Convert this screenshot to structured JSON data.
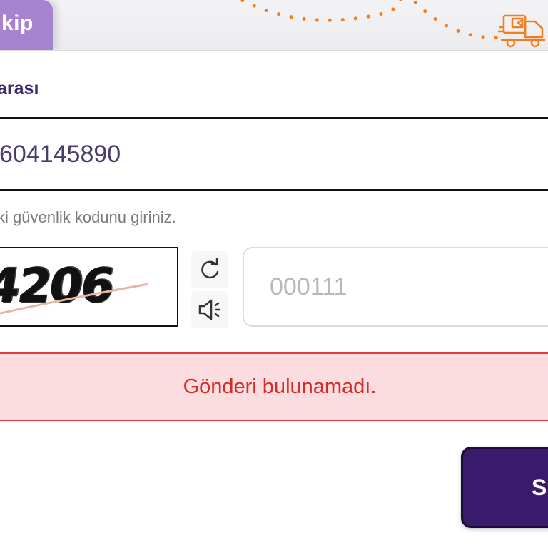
{
  "header": {
    "track_tab_label": "kip"
  },
  "tracking": {
    "label": "arası",
    "value": "604145890"
  },
  "captcha": {
    "hint": "ki güvenlik kodunu giriniz.",
    "image_text": "4206",
    "input_placeholder": "000111",
    "refresh_icon": "refresh-icon",
    "audio_icon": "speaker-icon"
  },
  "alert": {
    "message": "Gönderi bulunamadı."
  },
  "actions": {
    "submit_label": "S"
  },
  "colors": {
    "brand_purple": "#3a1a6a",
    "tab_purple": "#a583cf",
    "accent_orange": "#f07f1f",
    "error_red": "#d42b2b",
    "error_bg": "#fbdde0"
  }
}
